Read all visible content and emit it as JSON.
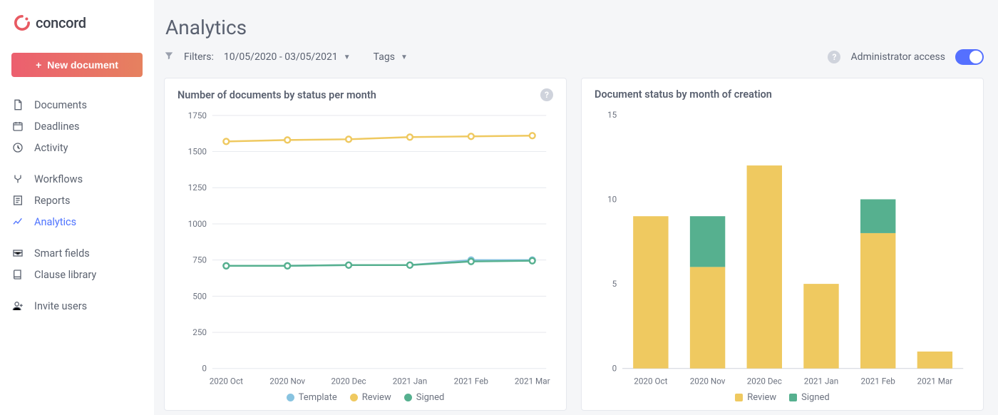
{
  "brand": {
    "name": "concord"
  },
  "sidebar": {
    "new_doc": "New document",
    "groups": {
      "a": [
        {
          "key": "documents",
          "label": "Documents"
        },
        {
          "key": "deadlines",
          "label": "Deadlines"
        },
        {
          "key": "activity",
          "label": "Activity"
        }
      ],
      "b": [
        {
          "key": "workflows",
          "label": "Workflows"
        },
        {
          "key": "reports",
          "label": "Reports"
        },
        {
          "key": "analytics",
          "label": "Analytics",
          "active": true
        }
      ],
      "c": [
        {
          "key": "smart-fields",
          "label": "Smart fields"
        },
        {
          "key": "clause-library",
          "label": "Clause library"
        }
      ],
      "d": [
        {
          "key": "invite-users",
          "label": "Invite users"
        }
      ]
    }
  },
  "page": {
    "title": "Analytics",
    "filters_label": "Filters:",
    "date_range": "10/05/2020 - 03/05/2021",
    "tags_label": "Tags",
    "admin_label": "Administrator access"
  },
  "chart_data": [
    {
      "id": "line",
      "type": "line",
      "title": "Number of documents by status per month",
      "categories": [
        "2020 Oct",
        "2020 Nov",
        "2020 Dec",
        "2021 Jan",
        "2021 Feb",
        "2021 Mar"
      ],
      "series": [
        {
          "name": "Template",
          "color": "#88c3e0",
          "values": [
            710,
            710,
            715,
            715,
            750,
            750
          ]
        },
        {
          "name": "Review",
          "color": "#efc960",
          "values": [
            1570,
            1580,
            1585,
            1600,
            1605,
            1610
          ]
        },
        {
          "name": "Signed",
          "color": "#56b08f",
          "values": [
            710,
            710,
            715,
            715,
            740,
            745
          ]
        }
      ],
      "yticks": [
        0,
        250,
        500,
        750,
        1000,
        1250,
        1500,
        1750
      ],
      "ylim": [
        0,
        1750
      ]
    },
    {
      "id": "bar",
      "type": "bar-stacked",
      "title": "Document status by month of creation",
      "categories": [
        "2020 Oct",
        "2020 Nov",
        "2020 Dec",
        "2021 Jan",
        "2021 Feb",
        "2021 Mar"
      ],
      "series": [
        {
          "name": "Review",
          "color": "#efc960",
          "values": [
            9,
            6,
            12,
            5,
            8,
            1
          ]
        },
        {
          "name": "Signed",
          "color": "#56b08f",
          "values": [
            0,
            3,
            0,
            0,
            2,
            0
          ]
        }
      ],
      "yticks": [
        0,
        5,
        10,
        15
      ],
      "ylim": [
        0,
        15
      ]
    }
  ]
}
